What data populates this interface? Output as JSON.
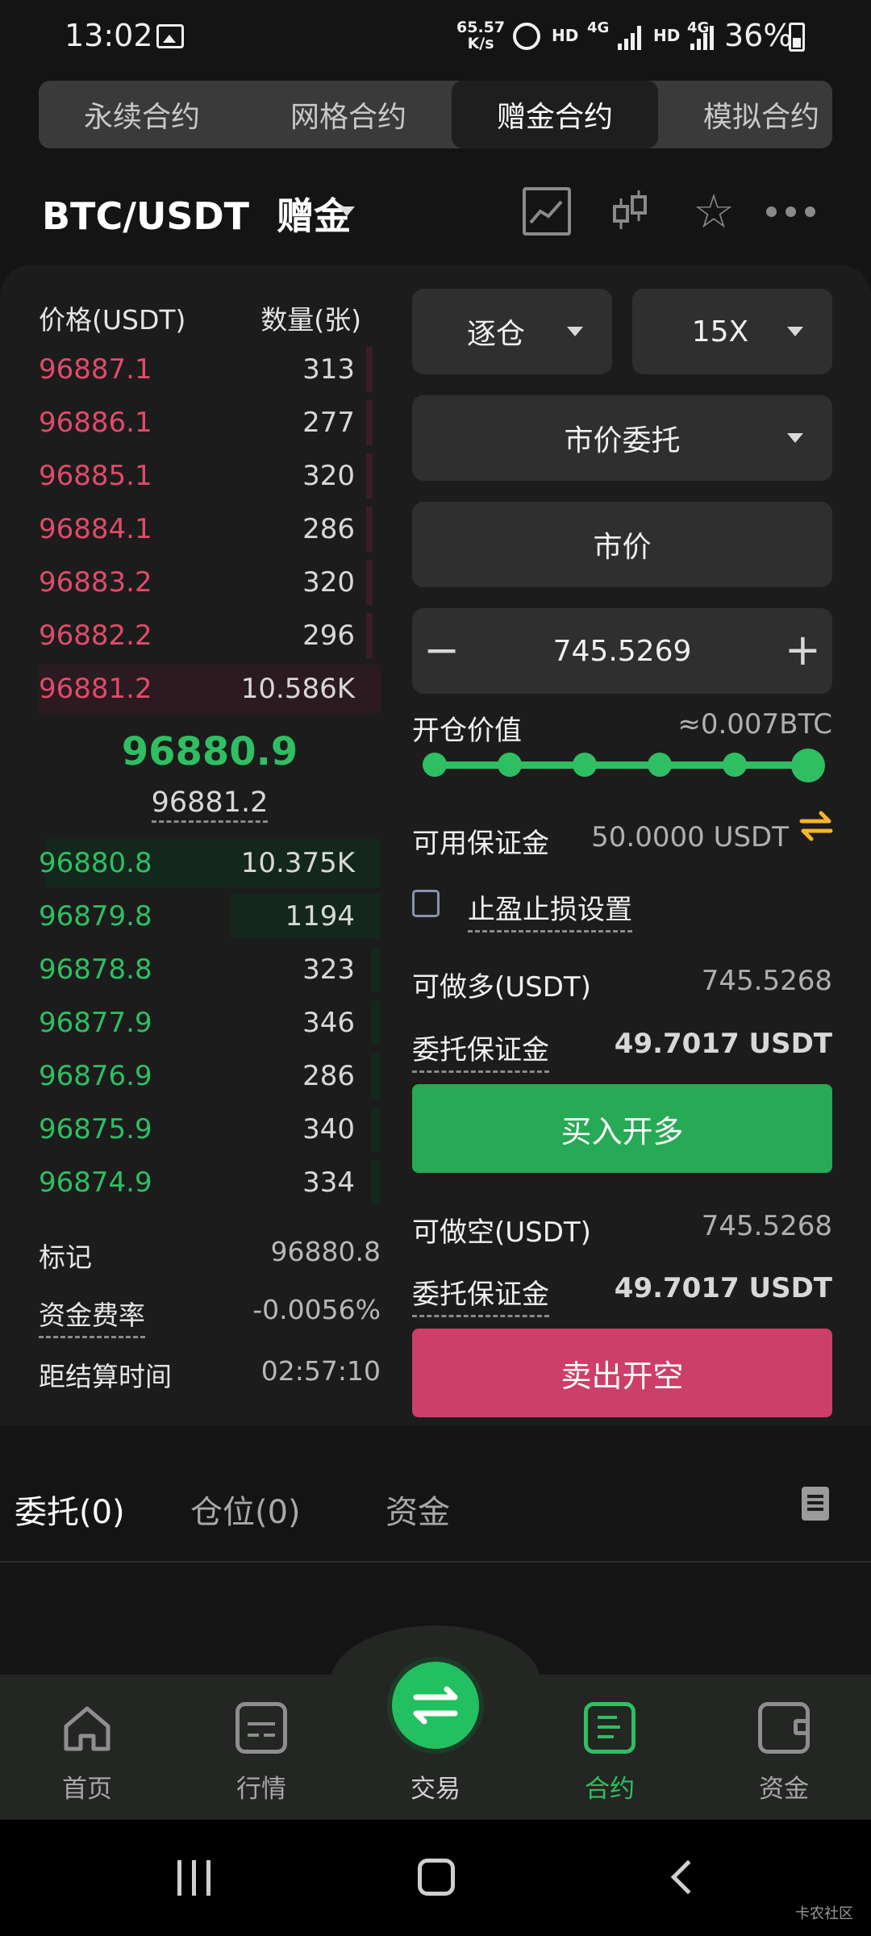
{
  "status": {
    "time": "13:02",
    "speed_value": "65.57",
    "speed_unit": "K/s",
    "hd": "HD",
    "net": "4G",
    "battery": "36%"
  },
  "top_tabs": [
    "永续合约",
    "网格合约",
    "赠金合约",
    "模拟合约"
  ],
  "top_tab_active": 2,
  "pair": "BTC/USDT",
  "pair_mode": "赠金",
  "orderbook": {
    "price_header": "价格(USDT)",
    "qty_header": "数量(张)",
    "asks": [
      {
        "price": "96887.1",
        "qty": "313"
      },
      {
        "price": "96886.1",
        "qty": "277"
      },
      {
        "price": "96885.1",
        "qty": "320"
      },
      {
        "price": "96884.1",
        "qty": "286"
      },
      {
        "price": "96883.2",
        "qty": "320"
      },
      {
        "price": "96882.2",
        "qty": "296"
      },
      {
        "price": "96881.2",
        "qty": "10.586K"
      }
    ],
    "last_price": "96880.9",
    "mark_under": "96881.2",
    "bids": [
      {
        "price": "96880.8",
        "qty": "10.375K"
      },
      {
        "price": "96879.8",
        "qty": "1194"
      },
      {
        "price": "96878.8",
        "qty": "323"
      },
      {
        "price": "96877.9",
        "qty": "346"
      },
      {
        "price": "96876.9",
        "qty": "286"
      },
      {
        "price": "96875.9",
        "qty": "340"
      },
      {
        "price": "96874.9",
        "qty": "334"
      }
    ]
  },
  "stats": {
    "mark_label": "标记",
    "mark_value": "96880.8",
    "funding_label": "资金费率",
    "funding_value": "-0.0056%",
    "settle_label": "距结算时间",
    "settle_value": "02:57:10"
  },
  "form": {
    "margin_mode": "逐仓",
    "leverage": "15X",
    "order_type": "市价委托",
    "price": "市价",
    "amount": "745.5269",
    "minus": "−",
    "plus": "+",
    "open_value_label": "开仓价值",
    "open_value": "≈0.007BTC",
    "slider_fraction": 1.0,
    "avail_margin_label": "可用保证金",
    "avail_margin": "50.0000 USDT",
    "tpsl_label": "止盈止损设置",
    "long_max_label": "可做多(USDT)",
    "long_max": "745.5268",
    "long_margin_label": "委托保证金",
    "long_margin": "49.7017 USDT",
    "buy_button": "买入开多",
    "short_max_label": "可做空(USDT)",
    "short_max": "745.5268",
    "short_margin_label": "委托保证金",
    "short_margin": "49.7017 USDT",
    "sell_button": "卖出开空"
  },
  "bottom_tabs": [
    "委托(0)",
    "仓位(0)",
    "资金"
  ],
  "nav": {
    "home": "首页",
    "market": "行情",
    "trade": "交易",
    "contract": "合约",
    "assets": "资金"
  },
  "watermark": "卡农社区",
  "colors": {
    "green": "#2fbf62",
    "red": "#e04b6a",
    "buy": "#27a955",
    "sell": "#cc3f68",
    "accent_swap": "#f5b52b"
  }
}
